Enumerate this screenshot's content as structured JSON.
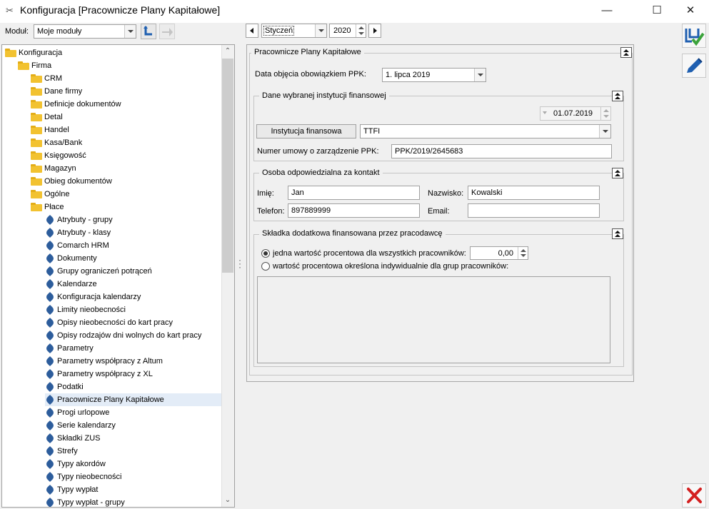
{
  "window": {
    "title": "Konfiguracja [Pracownicze Plany Kapitałowe]",
    "minimize": "—",
    "maximize": "☐",
    "close": "✕"
  },
  "toolbar": {
    "modul_label": "Moduł:",
    "modul_value": "Moje moduły"
  },
  "tree": {
    "items": [
      {
        "label": "Konfiguracja",
        "level": 0,
        "kind": "folder",
        "expander": "none"
      },
      {
        "label": "Firma",
        "level": 1,
        "kind": "folder",
        "expander": "open"
      },
      {
        "label": "CRM",
        "level": 2,
        "kind": "folder",
        "expander": "closed"
      },
      {
        "label": "Dane firmy",
        "level": 2,
        "kind": "folder",
        "expander": "closed"
      },
      {
        "label": "Definicje dokumentów",
        "level": 2,
        "kind": "folder",
        "expander": "closed"
      },
      {
        "label": "Detal",
        "level": 2,
        "kind": "folder",
        "expander": "closed"
      },
      {
        "label": "Handel",
        "level": 2,
        "kind": "folder",
        "expander": "closed"
      },
      {
        "label": "Kasa/Bank",
        "level": 2,
        "kind": "folder",
        "expander": "closed"
      },
      {
        "label": "Księgowość",
        "level": 2,
        "kind": "folder",
        "expander": "closed"
      },
      {
        "label": "Magazyn",
        "level": 2,
        "kind": "folder",
        "expander": "closed"
      },
      {
        "label": "Obieg dokumentów",
        "level": 2,
        "kind": "folder",
        "expander": "closed"
      },
      {
        "label": "Ogólne",
        "level": 2,
        "kind": "folder",
        "expander": "closed"
      },
      {
        "label": "Płace",
        "level": 2,
        "kind": "folder",
        "expander": "open"
      },
      {
        "label": "Atrybuty - grupy",
        "level": 3,
        "kind": "leaf"
      },
      {
        "label": "Atrybuty - klasy",
        "level": 3,
        "kind": "leaf"
      },
      {
        "label": "Comarch HRM",
        "level": 3,
        "kind": "leaf"
      },
      {
        "label": "Dokumenty",
        "level": 3,
        "kind": "leaf"
      },
      {
        "label": "Grupy ograniczeń potrąceń",
        "level": 3,
        "kind": "leaf"
      },
      {
        "label": "Kalendarze",
        "level": 3,
        "kind": "leaf"
      },
      {
        "label": "Konfiguracja kalendarzy",
        "level": 3,
        "kind": "leaf"
      },
      {
        "label": "Limity nieobecności",
        "level": 3,
        "kind": "leaf"
      },
      {
        "label": "Opisy nieobecności do kart pracy",
        "level": 3,
        "kind": "leaf"
      },
      {
        "label": "Opisy rodzajów dni wolnych do kart pracy",
        "level": 3,
        "kind": "leaf"
      },
      {
        "label": "Parametry",
        "level": 3,
        "kind": "leaf"
      },
      {
        "label": "Parametry współpracy z Altum",
        "level": 3,
        "kind": "leaf"
      },
      {
        "label": "Parametry współpracy z XL",
        "level": 3,
        "kind": "leaf"
      },
      {
        "label": "Podatki",
        "level": 3,
        "kind": "leaf"
      },
      {
        "label": "Pracownicze Plany Kapitałowe",
        "level": 3,
        "kind": "leaf",
        "selected": true
      },
      {
        "label": "Progi urlopowe",
        "level": 3,
        "kind": "leaf"
      },
      {
        "label": "Serie kalendarzy",
        "level": 3,
        "kind": "leaf"
      },
      {
        "label": "Składki ZUS",
        "level": 3,
        "kind": "leaf"
      },
      {
        "label": "Strefy",
        "level": 3,
        "kind": "leaf"
      },
      {
        "label": "Typy akordów",
        "level": 3,
        "kind": "leaf"
      },
      {
        "label": "Typy nieobecności",
        "level": 3,
        "kind": "leaf"
      },
      {
        "label": "Typy wypłat",
        "level": 3,
        "kind": "leaf"
      },
      {
        "label": "Typy wypłat - grupy",
        "level": 3,
        "kind": "leaf"
      }
    ]
  },
  "period": {
    "month": "Styczeń",
    "year": "2020"
  },
  "ppk": {
    "group_title": "Pracownicze Plany Kapitałowe",
    "data_label": "Data objęcia obowiązkiem PPK:",
    "data_value": "1. lipca 2019",
    "instytucja_group": {
      "title": "Dane wybranej instytucji finansowej",
      "date_value": "01.07.2019",
      "button_label": "Instytucja finansowa",
      "instytucja_value": "TTFI",
      "umowa_label": "Numer umowy o zarządzenie PPK:",
      "umowa_value": "PPK/2019/2645683"
    },
    "kontakt_group": {
      "title": "Osoba odpowiedzialna za kontakt",
      "imie_label": "Imię:",
      "imie_value": "Jan",
      "nazwisko_label": "Nazwisko:",
      "nazwisko_value": "Kowalski",
      "telefon_label": "Telefon:",
      "telefon_value": "897889999",
      "email_label": "Email:",
      "email_value": ""
    },
    "skladka_group": {
      "title": "Składka dodatkowa finansowana przez pracodawcę",
      "option1_label": "jedna wartość procentowa dla wszystkich pracowników:",
      "option1_value": "0,00",
      "option2_label": "wartość procentowa określona indywidualnie dla grup pracowników:"
    }
  },
  "colors": {
    "save_icon": "#1f5fb0",
    "save_check": "#3ba33b",
    "close_x": "#d42020",
    "folder": "#f2c230",
    "leaf": "#2d5d9c"
  }
}
